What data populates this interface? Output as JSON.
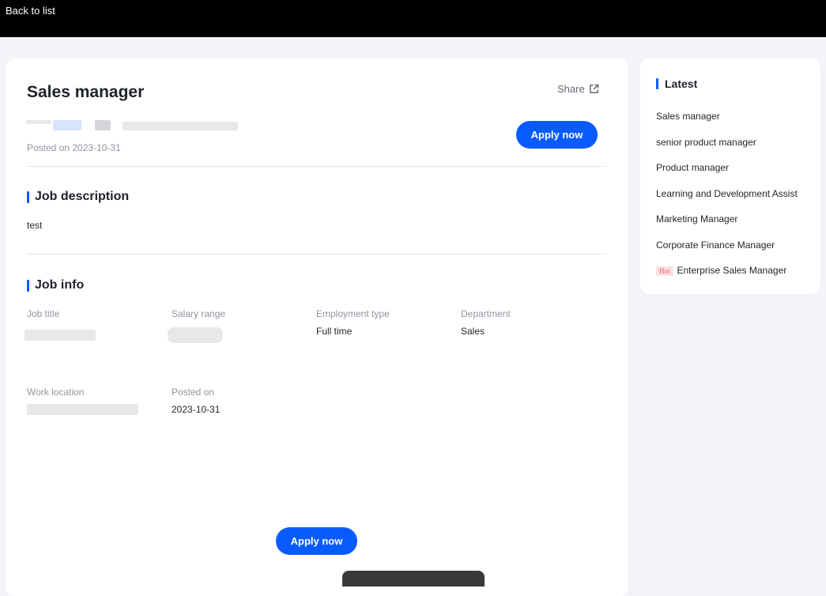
{
  "topbar": {
    "back_label": "Back to list"
  },
  "job": {
    "title": "Sales manager",
    "share_label": "Share",
    "posted": "Posted on 2023-10-31",
    "apply_label": "Apply now",
    "apply_bottom_label": "Apply now"
  },
  "description": {
    "heading": "Job description",
    "text": "test"
  },
  "info": {
    "heading": "Job info",
    "job_title_label": "Job title",
    "salary_label": "Salary range",
    "employment_label": "Employment type",
    "employment_value": "Full time",
    "department_label": "Department",
    "department_value": "Sales",
    "location_label": "Work location",
    "posted_label": "Posted on",
    "posted_value": "2023-10-31"
  },
  "latest": {
    "heading": "Latest",
    "items": [
      {
        "label": "Sales manager"
      },
      {
        "label": "senior product manager"
      },
      {
        "label": "Product manager"
      },
      {
        "label": "Learning and Development Assist"
      },
      {
        "label": "Marketing Manager"
      },
      {
        "label": "Corporate Finance Manager"
      },
      {
        "label": "Enterprise Sales Manager",
        "badge": "Hot"
      }
    ]
  },
  "colors": {
    "accent": "#0a5bff",
    "background": "#f2f4f7",
    "topbar": "#000000"
  }
}
